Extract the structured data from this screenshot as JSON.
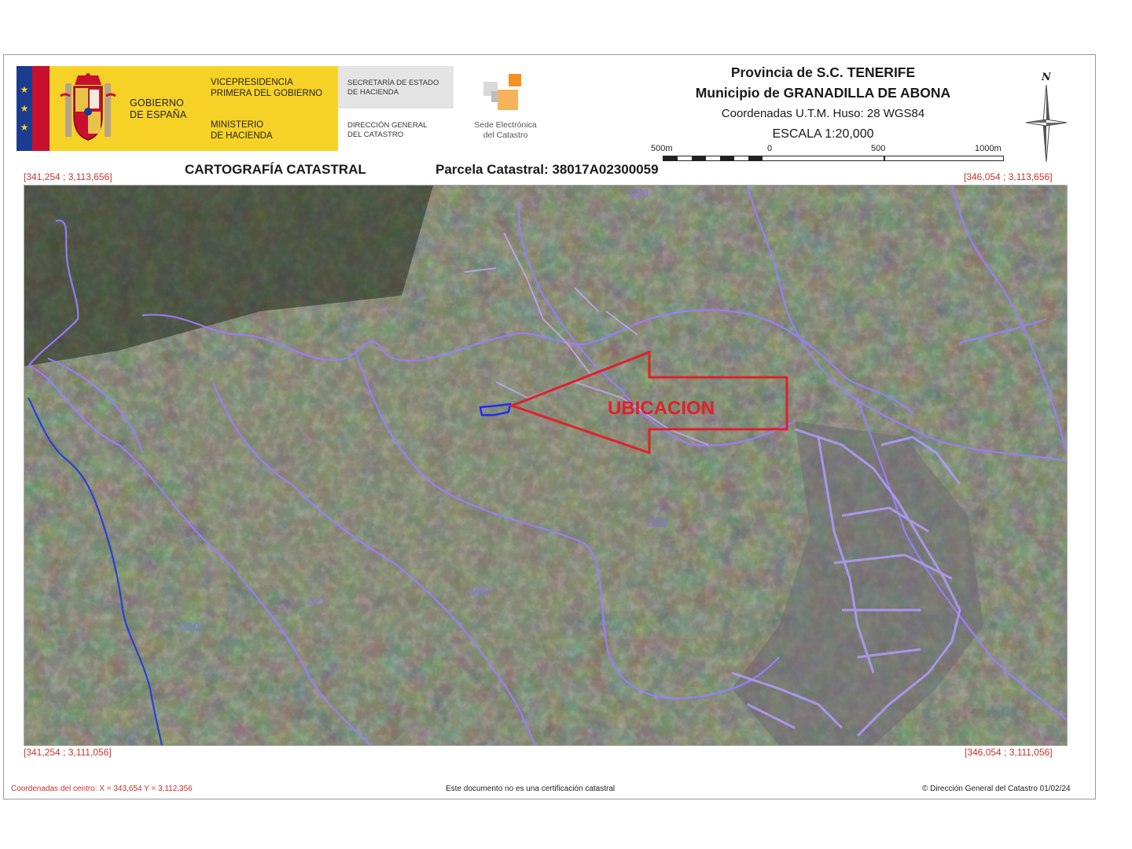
{
  "header": {
    "gobierno": "GOBIERNO\nDE ESPAÑA",
    "vicepresidencia": "VICEPRESIDENCIA\nPRIMERA DEL GOBIERNO",
    "ministerio": "MINISTERIO\nDE HACIENDA",
    "secretaria": "SECRETARÍA DE ESTADO\nDE HACIENDA",
    "direccion": "DIRECCIÓN GENERAL\nDEL CATASTRO",
    "sede": "Sede Electrónica\ndel Catastro",
    "brand_colors": {
      "yellow": "#f7d226",
      "red": "#c8102e",
      "blue": "#1b3c8f",
      "orange": "#f39223"
    }
  },
  "title": {
    "provincia": "Provincia de S.C. TENERIFE",
    "municipio": "Municipio de GRANADILLA DE ABONA",
    "coordenadas": "Coordenadas U.T.M. Huso: 28 WGS84",
    "escala": "ESCALA 1:20,000",
    "scale_labels": [
      "500m",
      "0",
      "500",
      "1000m"
    ],
    "north": "N"
  },
  "subheader": {
    "cartografia": "CARTOGRAFÍA CATASTRAL",
    "parcela": "Parcela Catastral: 38017A02300059"
  },
  "corners": {
    "top_left": "[341,254 ; 3,113,656]",
    "top_right": "[346,054 ; 3,113,656]",
    "bottom_left": "[341,254 ; 3,111,056]",
    "bottom_right": "[346,054 ; 3,111,056]"
  },
  "map": {
    "sheet_numbers": [
      "024",
      "023",
      "022",
      "021",
      "020"
    ],
    "annotation": "UBICACION",
    "colors": {
      "boundary": "#9b7cff",
      "river": "#2a3fd6",
      "arrow": "#e0202a",
      "parcel": "#1f2bff"
    }
  },
  "footer": {
    "centro": "Coordenadas del centro: X = 343,654 Y = 3,112,356",
    "aviso": "Este documento no es una certificación catastral",
    "copyright": "© Dirección General del Catastro 01/02/24"
  }
}
